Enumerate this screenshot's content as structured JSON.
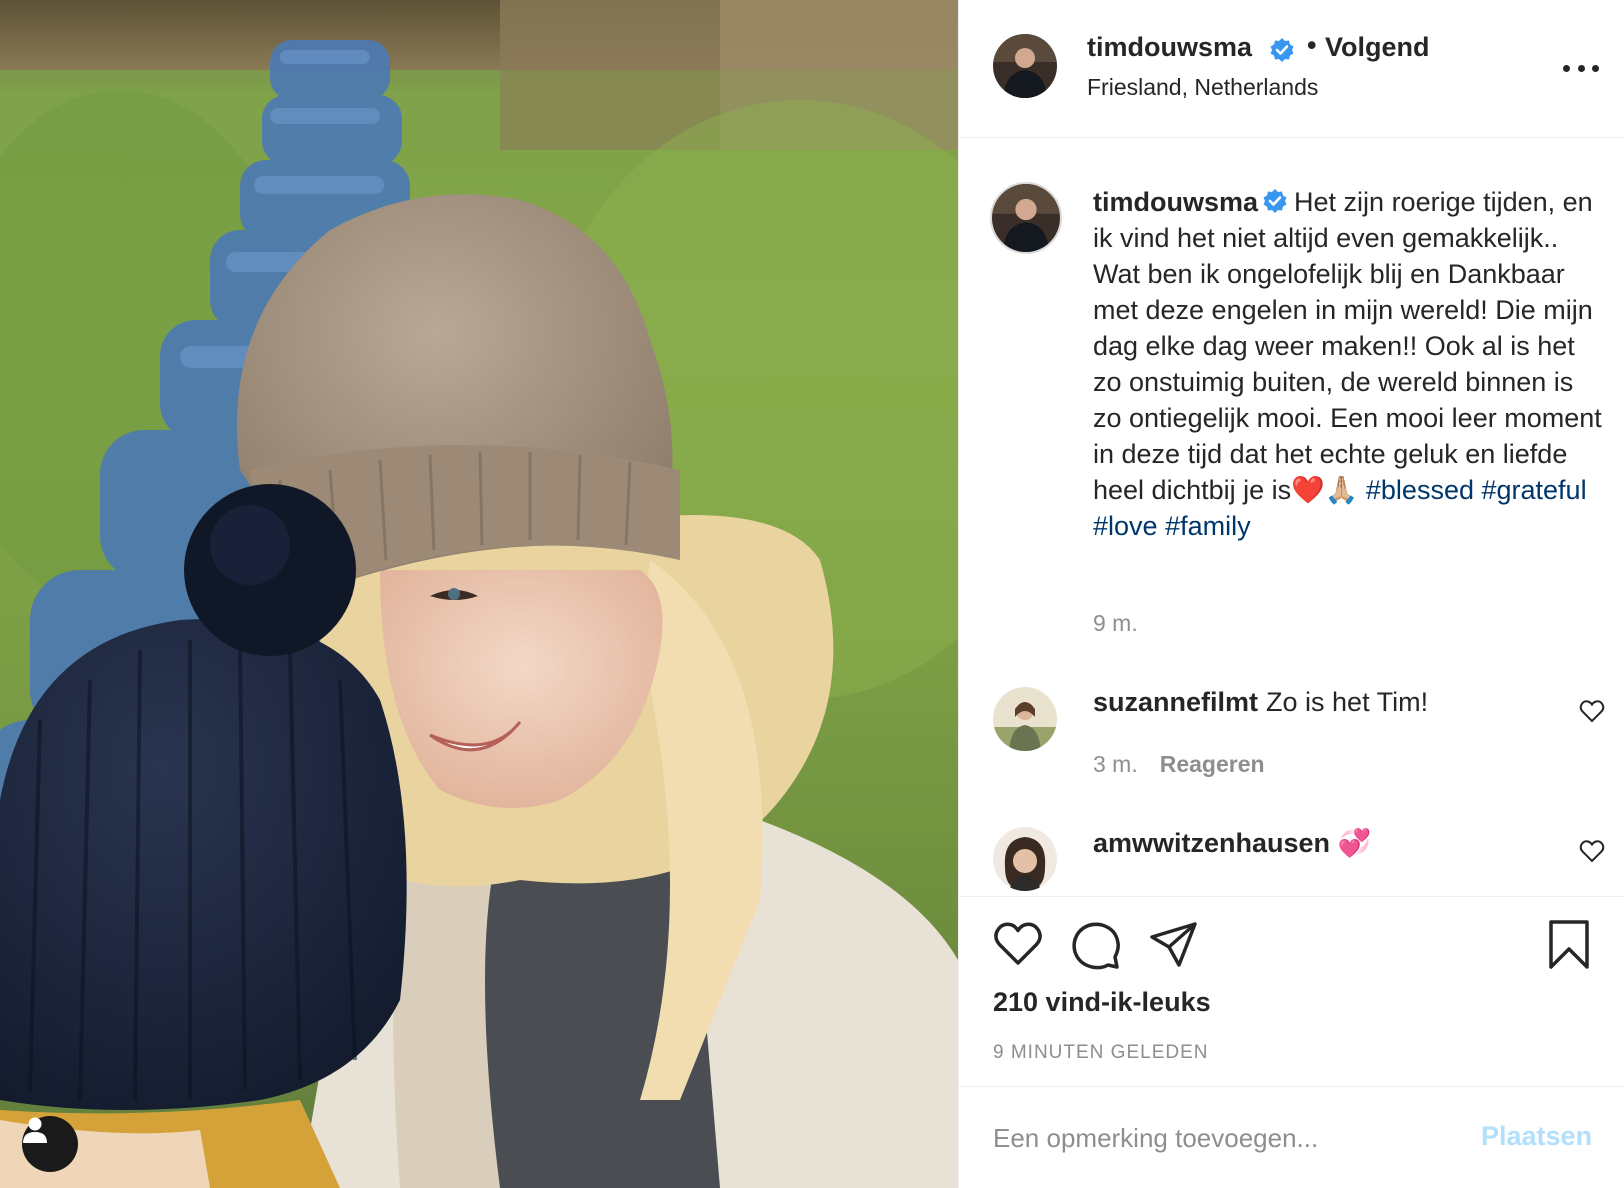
{
  "post": {
    "author": "timdouwsma",
    "follow_state": "Volgend",
    "location": "Friesland, Netherlands",
    "caption_text": "Het zijn roerige tijden, en ik vind het niet altijd even gemakkelijk.. Wat ben ik ongelofelijk blij en Dankbaar met deze engelen in mijn wereld! Die mijn dag elke dag weer maken!! Ook al is het zo onstuimig buiten, de wereld binnen is zo ontiegelijk mooi. Een mooi leer moment in deze tijd dat het echte geluk en liefde heel dichtbij je is",
    "caption_emoji": "❤️🙏🏼",
    "hashtags": [
      "#blessed",
      "#grateful",
      "#love",
      "#family"
    ],
    "caption_time": "9 m.",
    "likes": "210 vind-ik-leuks",
    "timestamp": "9 minuten geleden"
  },
  "comments": [
    {
      "author": "suzannefilmt",
      "text": "Zo is het Tim!",
      "time": "3 m.",
      "reply_label": "Reageren"
    },
    {
      "author": "amwwitzenhausen",
      "text": "💞"
    }
  ],
  "composer": {
    "placeholder": "Een opmerking toevoegen...",
    "post_label": "Plaatsen"
  },
  "icons": {
    "verified": "verified-badge-icon",
    "more": "more-options-icon",
    "like": "heart-icon",
    "comment": "comment-bubble-icon",
    "share": "paper-plane-icon",
    "save": "bookmark-icon",
    "tags": "user-tag-icon"
  },
  "colors": {
    "hashtag": "#00376b",
    "verified": "#3897f0",
    "post_button_disabled": "#b2dffc",
    "secondary_text": "#8e8e8e"
  }
}
